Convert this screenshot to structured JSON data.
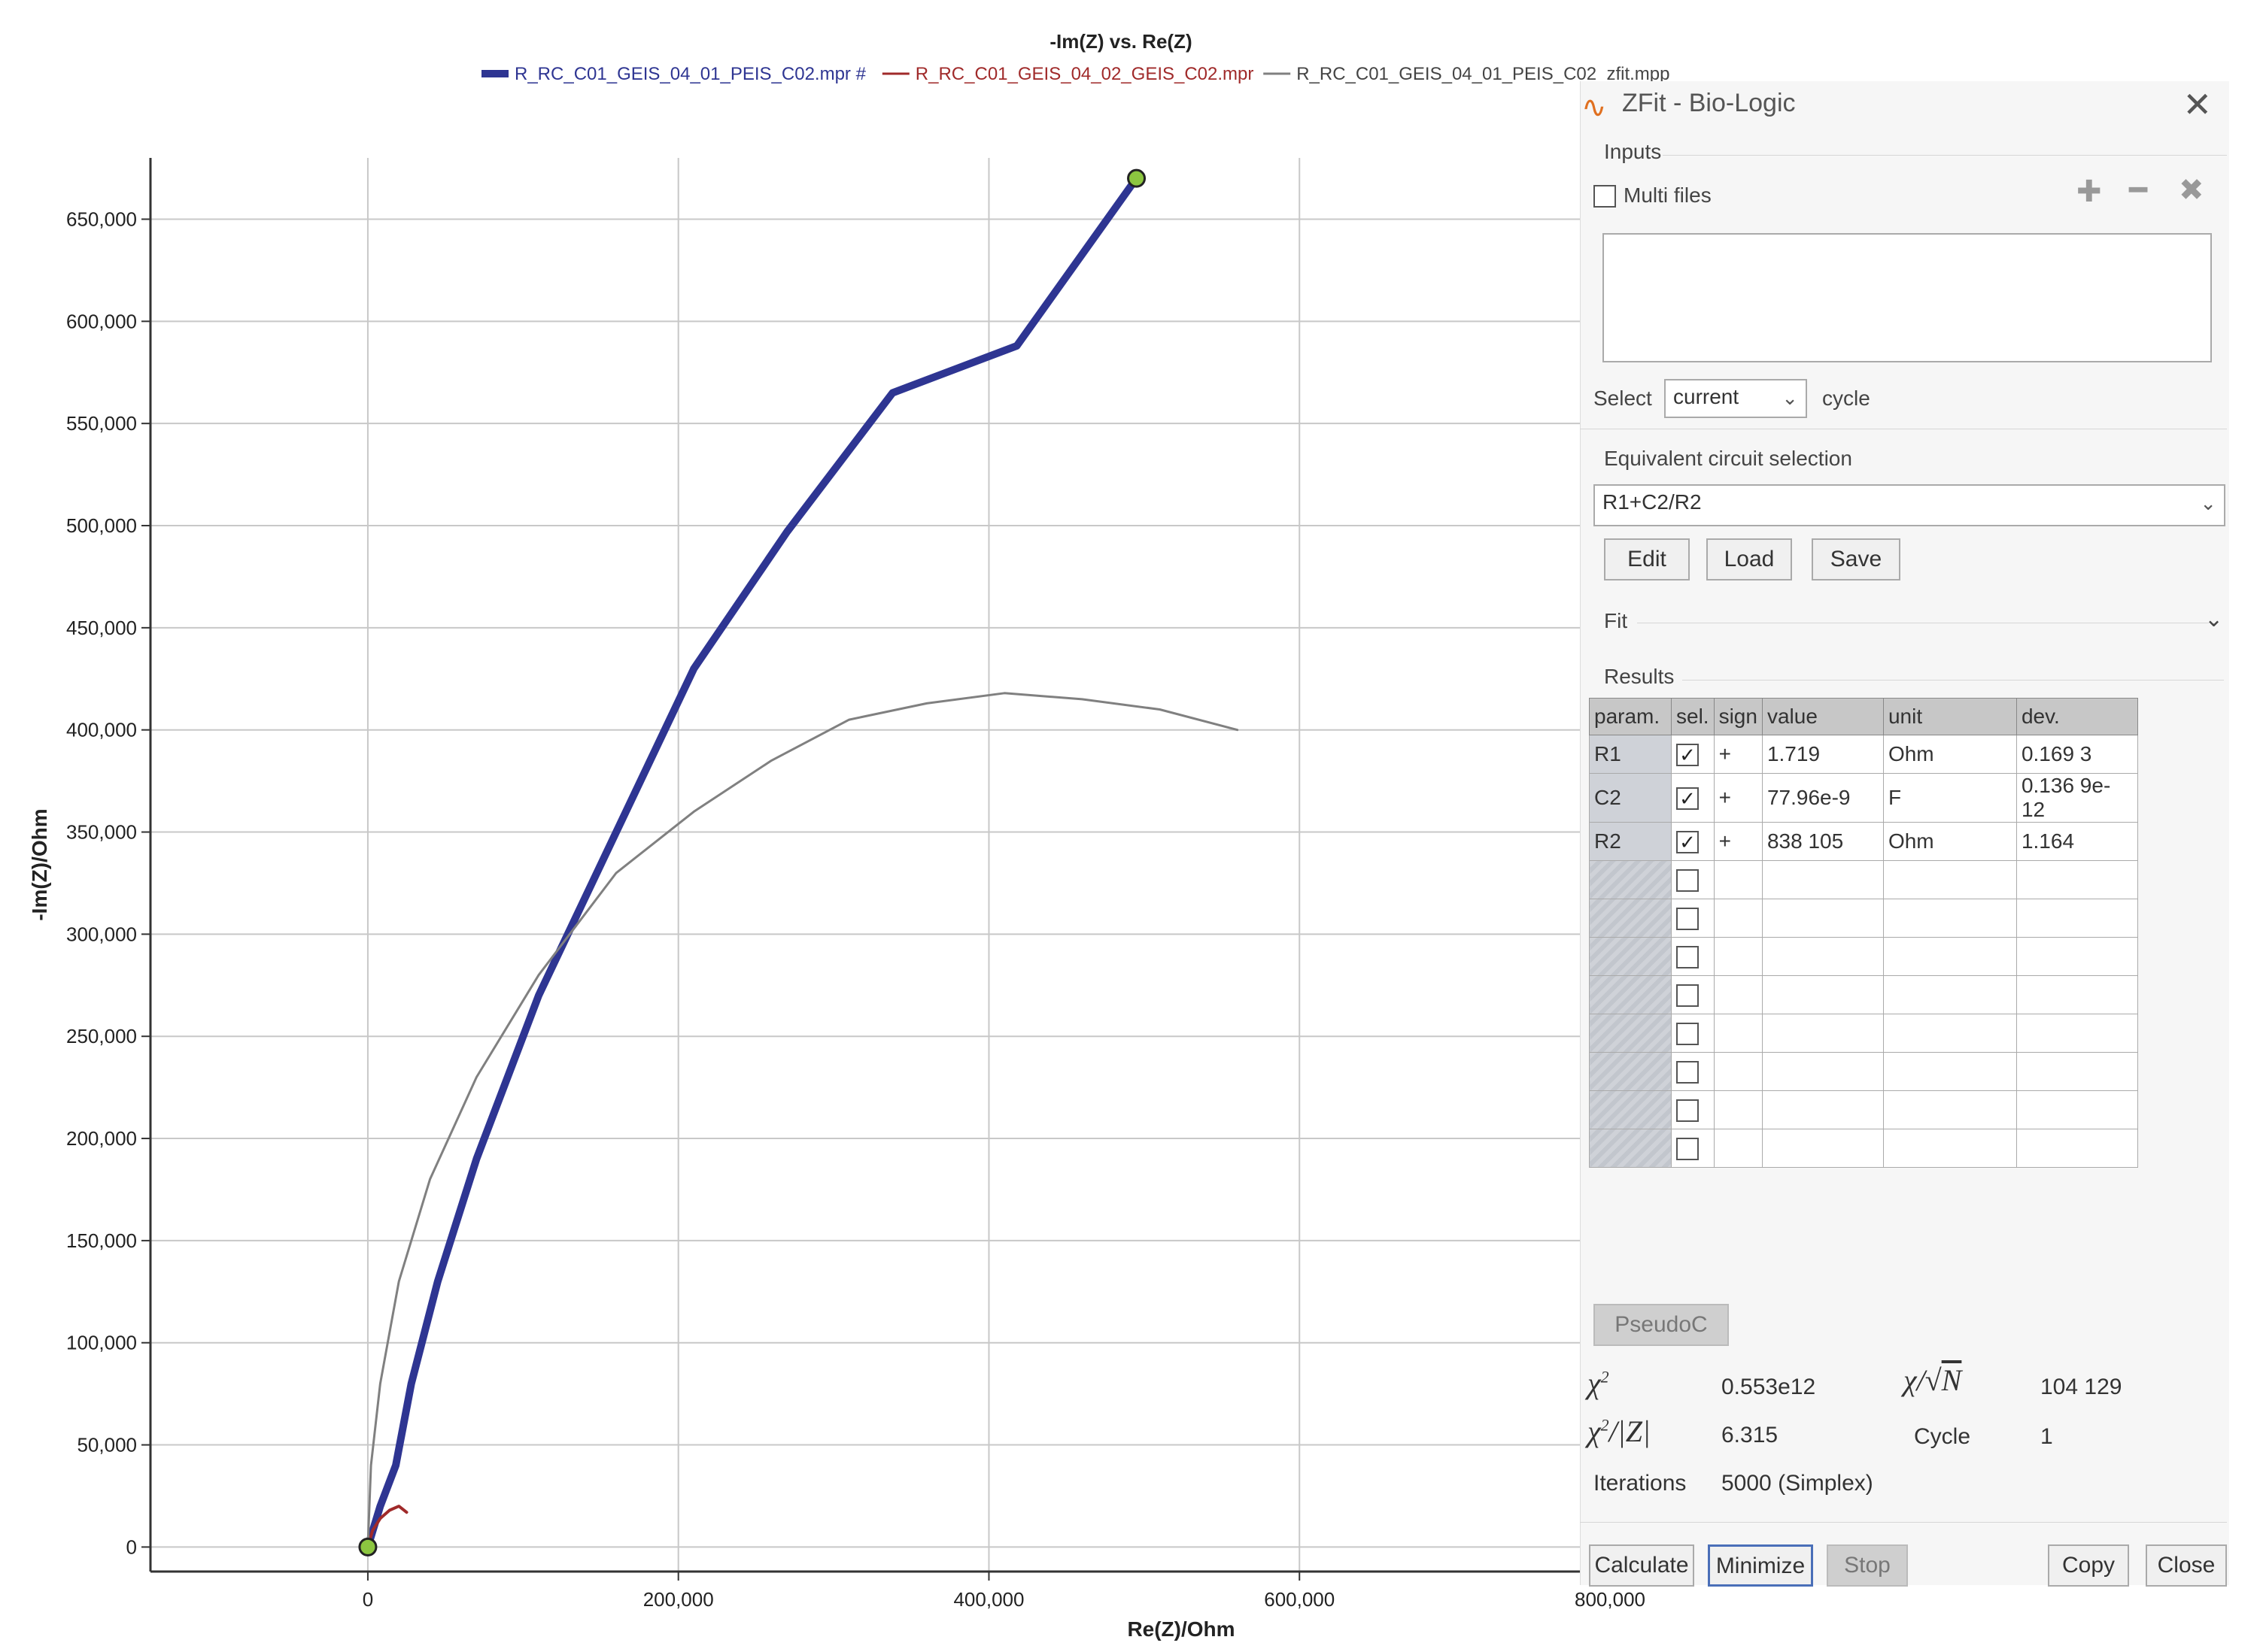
{
  "chart_data": {
    "type": "line",
    "title": "-Im(Z) vs. Re(Z)",
    "xlabel": "Re(Z)/Ohm",
    "ylabel": "-Im(Z)/Ohm",
    "xlim": [
      -140000,
      800000
    ],
    "ylim": [
      -12000,
      680000
    ],
    "xticks": [
      0,
      200000,
      400000,
      600000,
      800000
    ],
    "yticks": [
      0,
      50000,
      100000,
      150000,
      200000,
      250000,
      300000,
      350000,
      400000,
      450000,
      500000,
      550000,
      600000,
      650000
    ],
    "xtick_labels": [
      "0",
      "200,000",
      "400,000",
      "600,000",
      "800,000"
    ],
    "ytick_labels": [
      "0",
      "50,000",
      "100,000",
      "150,000",
      "200,000",
      "250,000",
      "300,000",
      "350,000",
      "400,000",
      "450,000",
      "500,000",
      "550,000",
      "600,000",
      "650,000"
    ],
    "grid": true,
    "legend_position": "top",
    "series": [
      {
        "name": "R_RC_C01_GEIS_04_01_PEIS_C02.mpr #",
        "color": "#2e3592",
        "points": [
          [
            0,
            0
          ],
          [
            8000,
            20000
          ],
          [
            18000,
            40000
          ],
          [
            20000,
            48000
          ],
          [
            28000,
            80000
          ],
          [
            45000,
            130000
          ],
          [
            70000,
            190000
          ],
          [
            110000,
            270000
          ],
          [
            160000,
            350000
          ],
          [
            210000,
            430000
          ],
          [
            270000,
            497000
          ],
          [
            338000,
            565000
          ],
          [
            418000,
            588000
          ],
          [
            495000,
            670000
          ]
        ]
      },
      {
        "name": "R_RC_C01_GEIS_04_02_GEIS_C02.mpr",
        "color": "#a02a2a",
        "points": [
          [
            0,
            0
          ],
          [
            3000,
            8000
          ],
          [
            8000,
            14000
          ],
          [
            14000,
            18000
          ],
          [
            20000,
            20000
          ],
          [
            25000,
            17000
          ]
        ]
      },
      {
        "name": "R_RC_C01_GEIS_04_01_PEIS_C02_zfit.mpp",
        "color": "#808080",
        "points": [
          [
            0,
            0
          ],
          [
            2000,
            40000
          ],
          [
            8000,
            80000
          ],
          [
            20000,
            130000
          ],
          [
            40000,
            180000
          ],
          [
            70000,
            230000
          ],
          [
            110000,
            280000
          ],
          [
            160000,
            330000
          ],
          [
            210000,
            360000
          ],
          [
            260000,
            385000
          ],
          [
            310000,
            405000
          ],
          [
            360000,
            413000
          ],
          [
            410000,
            418000
          ],
          [
            460000,
            415000
          ],
          [
            510000,
            410000
          ],
          [
            560000,
            400000
          ]
        ]
      }
    ]
  },
  "zfit": {
    "title": "ZFit - Bio-Logic",
    "inputs_label": "Inputs",
    "multi_files_label": "Multi files",
    "select_label": "Select",
    "select_value": "current",
    "cycle_label": "cycle",
    "eq_circuit_label": "Equivalent circuit selection",
    "eq_circuit_value": "R1+C2/R2",
    "edit_label": "Edit",
    "load_label": "Load",
    "save_label": "Save",
    "fit_label": "Fit",
    "results_label": "Results",
    "columns": [
      "param.",
      "sel.",
      "sign",
      "value",
      "unit",
      "dev."
    ],
    "rows": [
      {
        "param": "R1",
        "sel": true,
        "sign": "+",
        "value": "1.719",
        "unit": "Ohm",
        "dev": "0.169 3"
      },
      {
        "param": "C2",
        "sel": true,
        "sign": "+",
        "value": "77.96e-9",
        "unit": "F",
        "dev": "0.136 9e-12"
      },
      {
        "param": "R2",
        "sel": true,
        "sign": "+",
        "value": "838 105",
        "unit": "Ohm",
        "dev": "1.164"
      }
    ],
    "empty_rows": 8,
    "pseudoc_label": "PseudoC",
    "chi2_value": "0.553e12",
    "chi_sqrtn_value": "104 129",
    "chi2_z_value": "6.315",
    "cycle_label2": "Cycle",
    "cycle_value": "1",
    "iterations_label": "Iterations",
    "iterations_value": "5000 (Simplex)",
    "calculate_label": "Calculate",
    "minimize_label": "Minimize",
    "stop_label": "Stop",
    "copy_label": "Copy",
    "close_label": "Close"
  }
}
